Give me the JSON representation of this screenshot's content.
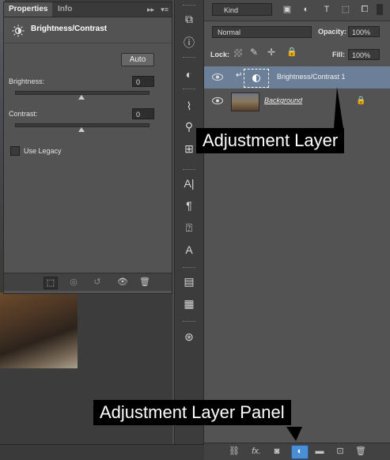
{
  "properties_panel": {
    "tabs": [
      "Properties",
      "Info"
    ],
    "collapse_glyph": "▸▸",
    "menu_glyph": "▾≡",
    "header_title": "Brightness/Contrast",
    "header_icon": "sun-icon",
    "auto_label": "Auto",
    "brightness_label": "Brightness:",
    "brightness_value": "0",
    "contrast_label": "Contrast:",
    "contrast_value": "0",
    "legacy_label": "Use Legacy",
    "footer_icons": [
      "clip-to-layer-icon",
      "view-previous-icon",
      "reset-icon",
      "visibility-icon",
      "delete-icon"
    ]
  },
  "toolbar": {
    "icons": [
      "history-brush-icon",
      "info-icon",
      "adjustment-icon",
      "brush-presets-icon",
      "clone-source-icon",
      "character-icon",
      "paragraph-icon",
      "character-styles-icon",
      "paragraph-styles-icon",
      "notes-icon",
      "actions-icon",
      "timeline-icon"
    ]
  },
  "layers_panel": {
    "filter_kind": "Kind",
    "filter_icons": [
      "pixel-filter-icon",
      "adjustment-filter-icon",
      "type-filter-icon",
      "shape-filter-icon",
      "smart-object-filter-icon"
    ],
    "blend_mode": "Normal",
    "opacity_label": "Opacity:",
    "opacity_value": "100%",
    "lock_label": "Lock:",
    "fill_label": "Fill:",
    "fill_value": "100%",
    "layers": [
      {
        "name": "Brightness/Contrast 1",
        "selected": true,
        "type": "adjustment"
      },
      {
        "name": "Background",
        "selected": false,
        "type": "image",
        "locked": true
      }
    ],
    "footer_icons": [
      "link-icon",
      "fx-icon",
      "mask-icon",
      "new-adjustment-icon",
      "folder-icon",
      "new-layer-icon",
      "trash-icon"
    ]
  },
  "callouts": {
    "adjustment_layer": "Adjustment Layer",
    "adjustment_layer_panel": "Adjustment Layer Panel"
  },
  "colors": {
    "panel_bg": "#535353",
    "selected_layer": "#6b7f99",
    "callout_bg": "#000000",
    "highlight_button": "#4a8fd6"
  }
}
